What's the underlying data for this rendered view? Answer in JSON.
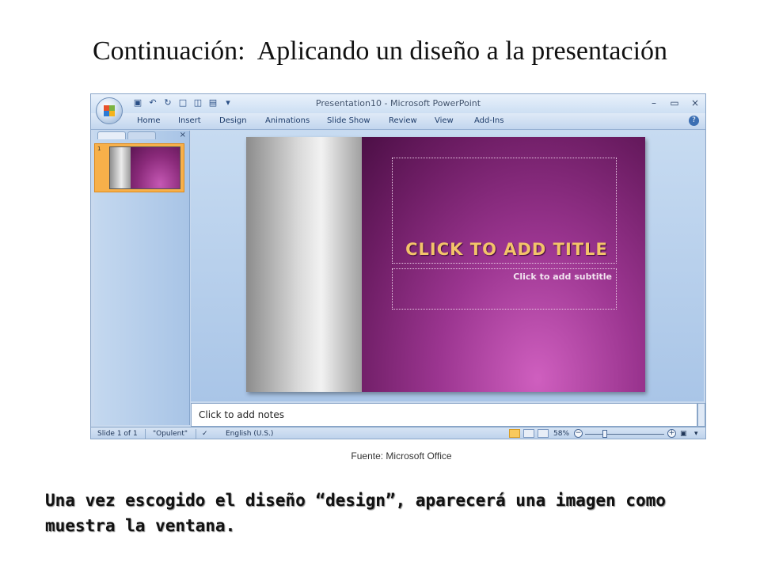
{
  "slide": {
    "title": "Continuación:  Aplicando un diseño a la presentación",
    "source": "Fuente:  Microsoft Office",
    "caption": "Una vez escogido el diseño “design”, aparecerá una imagen como muestra la ventana."
  },
  "window": {
    "title": "Presentation10 - Microsoft PowerPoint",
    "controls": [
      "–",
      "▭",
      "×"
    ]
  },
  "ribbon": {
    "tabs": [
      "Home",
      "Insert",
      "Design",
      "Animations",
      "Slide Show",
      "Review",
      "View",
      "Add-Ins"
    ],
    "help": "?"
  },
  "slides_panel": {
    "close": "×",
    "thumbnail_number": "1"
  },
  "slide_canvas": {
    "title_placeholder": "CLICK TO ADD TITLE",
    "subtitle_placeholder": "Click to add subtitle"
  },
  "notes": {
    "placeholder": "Click to add notes"
  },
  "statusbar": {
    "slide_info": "Slide 1 of 1",
    "theme": "\"Opulent\"",
    "language": "English (U.S.)",
    "zoom": "58%",
    "zoom_percent": 58
  },
  "colors": {
    "theme_purple": "#8a2a7a",
    "title_gold": "#f3c36a",
    "ribbon_blue": "#c2d6ee"
  }
}
